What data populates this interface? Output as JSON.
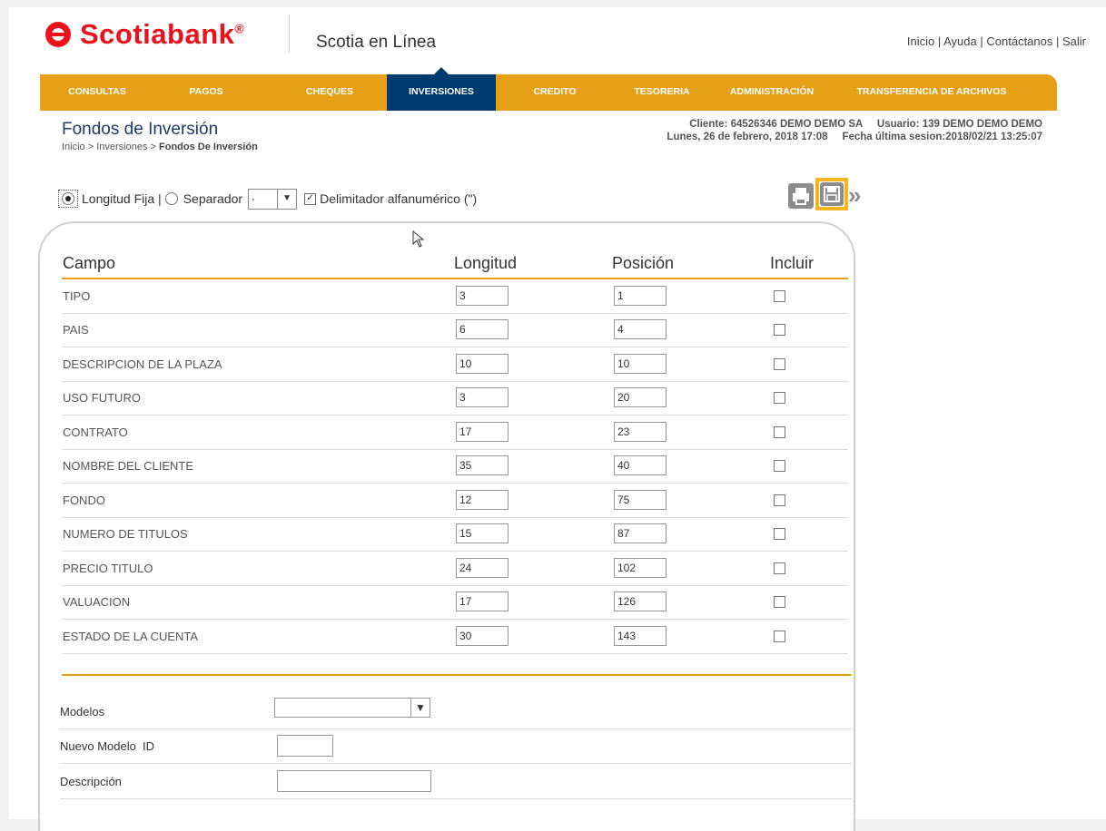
{
  "header": {
    "brand": "Scotiabank",
    "brand_mark": "®",
    "app_title": "Scotia en Línea",
    "links": [
      "Inicio",
      "Ayuda",
      "Contáctanos",
      "Salir"
    ],
    "link_separator": " | "
  },
  "nav": {
    "items": [
      {
        "label": "CONSULTAS"
      },
      {
        "label": "PAGOS"
      },
      {
        "label": "CHEQUES"
      },
      {
        "label": "INVERSIONES",
        "active": true
      },
      {
        "label": "CREDITO"
      },
      {
        "label": "TESORERIA"
      },
      {
        "label": "ADMINISTRACIÓN"
      },
      {
        "label": "TRANSFERENCIA DE ARCHIVOS"
      }
    ]
  },
  "page": {
    "title": "Fondos de Inversión",
    "breadcrumb_prefix": "Inicio > Inversiones > ",
    "breadcrumb_current": "Fondos De Inversión"
  },
  "client": {
    "line1": "Cliente: 64526346 DEMO DEMO SA     Usuario: 139 DEMO DEMO DEMO",
    "line2": "Lunes, 26 de febrero, 2018 17:08     Fecha última sesion:2018/02/21 13:25:07"
  },
  "options": {
    "fixed_length_label": "Longitud Fija |",
    "separator_label": "Separador",
    "separator_value": ",",
    "delimiter_label": "Delimitador alfanumérico (\")",
    "fixed_length_selected": true,
    "delimiter_checked": true
  },
  "colors": {
    "nav_orange": "#e6a016",
    "nav_active": "#003b70",
    "brand_red": "#ec111a",
    "highlight": "#f2b51d"
  },
  "grid": {
    "headers": {
      "campo": "Campo",
      "longitud": "Longitud",
      "posicion": "Posición",
      "incluir": "Incluir"
    },
    "rows": [
      {
        "campo": "TIPO",
        "longitud": "3",
        "posicion": "1"
      },
      {
        "campo": "PAIS",
        "longitud": "6",
        "posicion": "4"
      },
      {
        "campo": "DESCRIPCION DE LA PLAZA",
        "longitud": "10",
        "posicion": "10"
      },
      {
        "campo": "USO FUTURO",
        "longitud": "3",
        "posicion": "20"
      },
      {
        "campo": "CONTRATO",
        "longitud": "17",
        "posicion": "23"
      },
      {
        "campo": "NOMBRE DEL CLIENTE",
        "longitud": "35",
        "posicion": "40"
      },
      {
        "campo": "FONDO",
        "longitud": "12",
        "posicion": "75"
      },
      {
        "campo": "NUMERO DE TITULOS",
        "longitud": "15",
        "posicion": "87"
      },
      {
        "campo": "PRECIO TITULO",
        "longitud": "24",
        "posicion": "102"
      },
      {
        "campo": "VALUACION",
        "longitud": "17",
        "posicion": "126"
      },
      {
        "campo": "ESTADO DE LA CUENTA",
        "longitud": "30",
        "posicion": "143"
      }
    ]
  },
  "form": {
    "modelos_label": "Modelos",
    "modelos_value": "",
    "nuevo_modelo_label": "Nuevo Modelo  ID",
    "descripcion_label": "Descripción"
  },
  "icons": {
    "print": "print-icon",
    "save": "save-icon",
    "next": "next-icon"
  }
}
